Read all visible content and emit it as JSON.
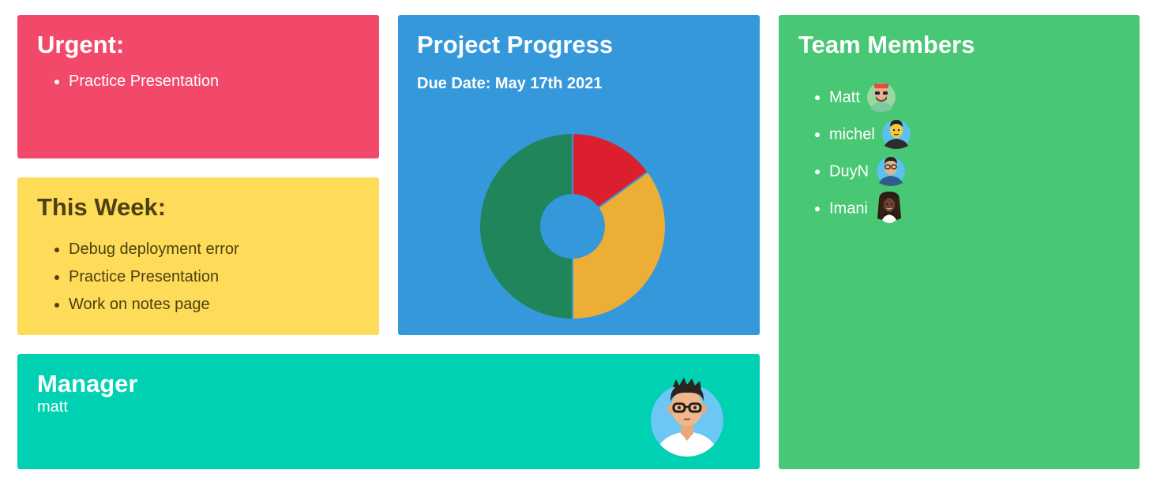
{
  "urgent": {
    "title": "Urgent:",
    "items": [
      "Practice Presentation"
    ]
  },
  "this_week": {
    "title": "This Week:",
    "items": [
      "Debug deployment error",
      "Practice Presentation",
      "Work on notes page"
    ]
  },
  "project": {
    "title": "Project Progress",
    "due_date": "Due Date: May 17th 2021",
    "chart_data": {
      "type": "pie",
      "slices": [
        {
          "value": 15,
          "color": "#dc1f2f"
        },
        {
          "value": 35,
          "color": "#ecae35"
        },
        {
          "value": 50,
          "color": "#20855a"
        }
      ]
    }
  },
  "manager": {
    "title": "Manager",
    "name": "matt",
    "avatar_icon": "manager-avatar-icon"
  },
  "team": {
    "title": "Team Members",
    "members": [
      {
        "name": "Matt",
        "avatar_bg": "#9ad7a3"
      },
      {
        "name": "michel",
        "avatar_bg": "#5cc0f0"
      },
      {
        "name": "DuyN",
        "avatar_bg": "#5cc0f0"
      },
      {
        "name": "Imani",
        "avatar_bg": "#48c774"
      }
    ]
  },
  "colors": {
    "urgent": "#f2496b",
    "this_week": "#fedb58",
    "project": "#3498db",
    "manager": "#00d1b2",
    "team": "#48c774"
  }
}
